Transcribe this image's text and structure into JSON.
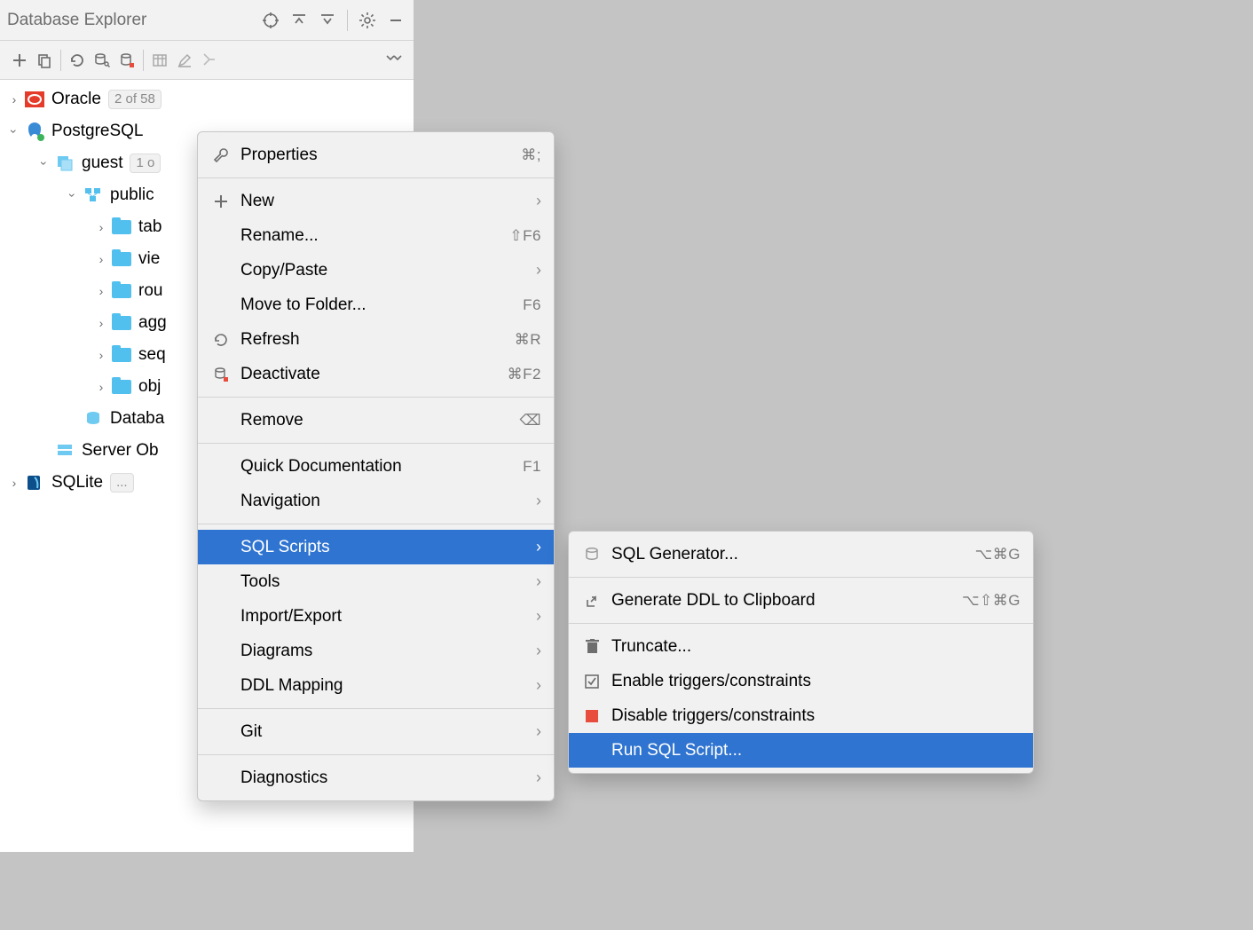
{
  "explorer": {
    "title": "Database Explorer",
    "tree": {
      "oracle": {
        "label": "Oracle",
        "chip": "2 of 58"
      },
      "postgres": {
        "label": "PostgreSQL"
      },
      "guest": {
        "label": "guest",
        "chip": "1 o"
      },
      "public": {
        "label": "public"
      },
      "tables": {
        "label": "tab"
      },
      "views": {
        "label": "vie"
      },
      "routines": {
        "label": "rou"
      },
      "aggregates": {
        "label": "agg"
      },
      "sequences": {
        "label": "seq"
      },
      "objects": {
        "label": "obj"
      },
      "dbtriggers": {
        "label": "Databa"
      },
      "serverobj": {
        "label": "Server Ob"
      },
      "sqlite": {
        "label": "SQLite",
        "chip": "..."
      }
    }
  },
  "menu": {
    "properties": {
      "label": "Properties",
      "shortcut": "⌘;"
    },
    "new": {
      "label": "New"
    },
    "rename": {
      "label": "Rename...",
      "shortcut": "⇧F6"
    },
    "copypaste": {
      "label": "Copy/Paste"
    },
    "movefolder": {
      "label": "Move to Folder...",
      "shortcut": "F6"
    },
    "refresh": {
      "label": "Refresh",
      "shortcut": "⌘R"
    },
    "deactivate": {
      "label": "Deactivate",
      "shortcut": "⌘F2"
    },
    "remove": {
      "label": "Remove",
      "shortcut": "⌫"
    },
    "quickdoc": {
      "label": "Quick Documentation",
      "shortcut": "F1"
    },
    "navigation": {
      "label": "Navigation"
    },
    "sqlscripts": {
      "label": "SQL Scripts"
    },
    "tools": {
      "label": "Tools"
    },
    "importexport": {
      "label": "Import/Export"
    },
    "diagrams": {
      "label": "Diagrams"
    },
    "ddlmapping": {
      "label": "DDL Mapping"
    },
    "git": {
      "label": "Git"
    },
    "diagnostics": {
      "label": "Diagnostics"
    }
  },
  "submenu": {
    "sqlgen": {
      "label": "SQL Generator...",
      "shortcut": "⌥⌘G"
    },
    "genddl": {
      "label": "Generate DDL to Clipboard",
      "shortcut": "⌥⇧⌘G"
    },
    "truncate": {
      "label": "Truncate..."
    },
    "enabletrig": {
      "label": "Enable triggers/constraints"
    },
    "disabletrig": {
      "label": "Disable triggers/constraints"
    },
    "runscript": {
      "label": "Run SQL Script..."
    }
  }
}
